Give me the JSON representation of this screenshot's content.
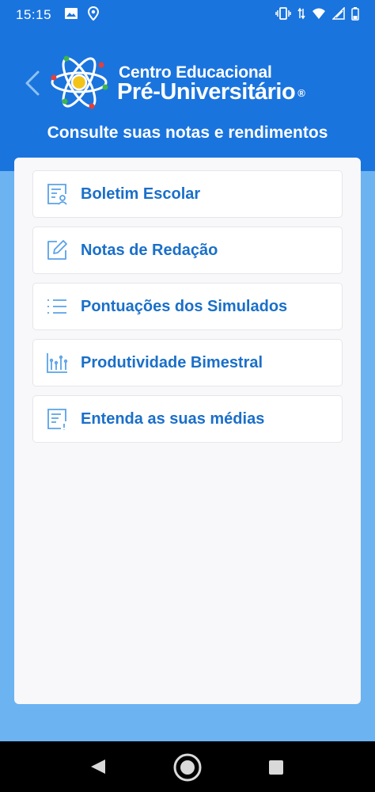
{
  "status_bar": {
    "time": "15:15"
  },
  "header": {
    "brand_line1": "Centro Educacional",
    "brand_line2": "Pré-Universitário",
    "brand_reg": "®",
    "subtitle": "Consulte suas notas e rendimentos"
  },
  "menu": {
    "items": [
      {
        "label": "Boletim Escolar",
        "icon": "report-card-icon"
      },
      {
        "label": "Notas de Redação",
        "icon": "edit-icon"
      },
      {
        "label": "Pontuações dos Simulados",
        "icon": "list-icon"
      },
      {
        "label": "Produtividade Bimestral",
        "icon": "bar-chart-icon"
      },
      {
        "label": "Entenda as suas médias",
        "icon": "info-document-icon"
      }
    ]
  },
  "colors": {
    "header_blue": "#1a74de",
    "background_light_blue": "#6cb3f2",
    "label_blue": "#1a6fc9",
    "icon_blue": "#5aa2e8"
  }
}
